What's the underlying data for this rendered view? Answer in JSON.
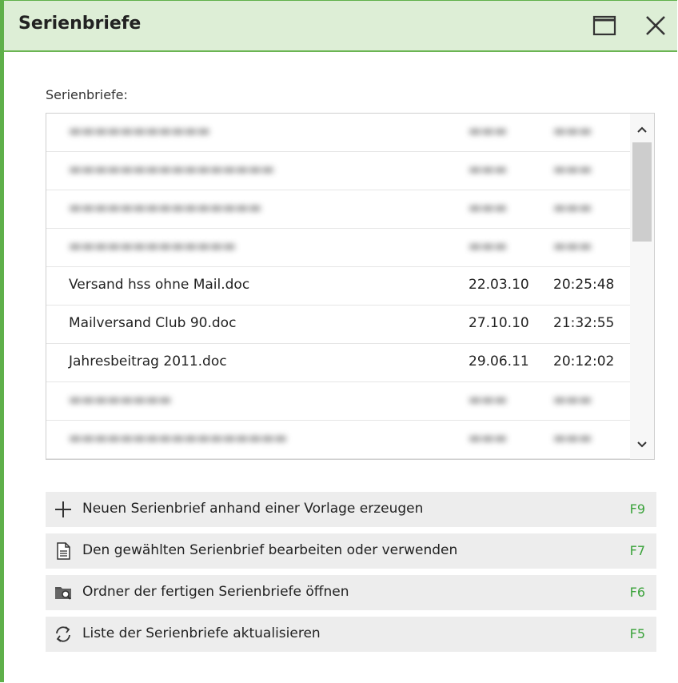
{
  "window": {
    "title": "Serienbriefe"
  },
  "list": {
    "label": "Serienbriefe:",
    "rows": [
      {
        "name": "Versand hss ohne Mail.doc",
        "date": "22.03.10",
        "time": "20:25:48",
        "blurred": false
      },
      {
        "name": "Mailversand Club 90.doc",
        "date": "27.10.10",
        "time": "21:32:55",
        "blurred": false
      },
      {
        "name": "Jahresbeitrag 2011.doc",
        "date": "29.06.11",
        "time": "20:12:02",
        "blurred": false
      }
    ]
  },
  "actions": [
    {
      "icon": "plus-icon",
      "label": "Neuen Serienbrief anhand einer Vorlage erzeugen",
      "key": "F9"
    },
    {
      "icon": "document-icon",
      "label": "Den gewählten Serienbrief bearbeiten oder verwenden",
      "key": "F7"
    },
    {
      "icon": "folder-search-icon",
      "label": "Ordner der fertigen Serienbriefe öffnen",
      "key": "F6"
    },
    {
      "icon": "refresh-icon",
      "label": "Liste der Serienbriefe aktualisieren",
      "key": "F5"
    }
  ],
  "colors": {
    "accent": "#5fb04a",
    "titlebar": "#ddeed6",
    "key": "#3aa23a"
  }
}
